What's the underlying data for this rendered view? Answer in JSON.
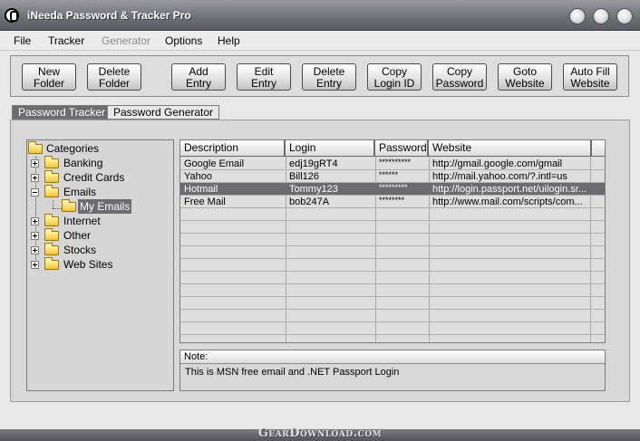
{
  "window": {
    "title": "iNeeda Password & Tracker Pro"
  },
  "menu": [
    {
      "label": "File",
      "enabled": true
    },
    {
      "label": "Tracker",
      "enabled": true
    },
    {
      "label": "Generator",
      "enabled": false
    },
    {
      "label": "Options",
      "enabled": true
    },
    {
      "label": "Help",
      "enabled": true
    }
  ],
  "toolbar": [
    {
      "label": "New\nFolder"
    },
    {
      "label": "Delete\nFolder"
    },
    {
      "label": "Add\nEntry"
    },
    {
      "label": "Edit\nEntry"
    },
    {
      "label": "Delete\nEntry"
    },
    {
      "label": "Copy\nLogin ID"
    },
    {
      "label": "Copy\nPassword"
    },
    {
      "label": "Goto\nWebsite"
    },
    {
      "label": "Auto Fill\nWebsite"
    }
  ],
  "tabs": [
    {
      "label": "Password Tracker",
      "active": true
    },
    {
      "label": "Password Generator",
      "active": false
    }
  ],
  "tree": {
    "root": "Categories",
    "folders": [
      "Banking",
      "Credit Cards",
      "Emails",
      "Internet",
      "Other",
      "Stocks",
      "Web Sites"
    ],
    "expanded": "Emails",
    "selected_child": "My Emails"
  },
  "grid": {
    "columns": [
      "Description",
      "Login",
      "Password",
      "Website"
    ],
    "rows": [
      {
        "description": "Google Email",
        "login": "edj19gRT4",
        "password": "**********",
        "website": "http://gmail.google.com/gmail",
        "selected": false
      },
      {
        "description": "Yahoo",
        "login": "Bill126",
        "password": "******",
        "website": "http://mail.yahoo.com/?.intl=us",
        "selected": false
      },
      {
        "description": "Hotmail",
        "login": "Tommy123",
        "password": "*********",
        "website": "http://login.passport.net/uilogin.sr...",
        "selected": true
      },
      {
        "description": "Free Mail",
        "login": "bob247A",
        "password": "********",
        "website": "http://www.mail.com/scripts/com...",
        "selected": false
      }
    ]
  },
  "note": {
    "label": "Note:",
    "text": "This is MSN free email and .NET Passport Login"
  },
  "watermark": "GearDownload.com"
}
